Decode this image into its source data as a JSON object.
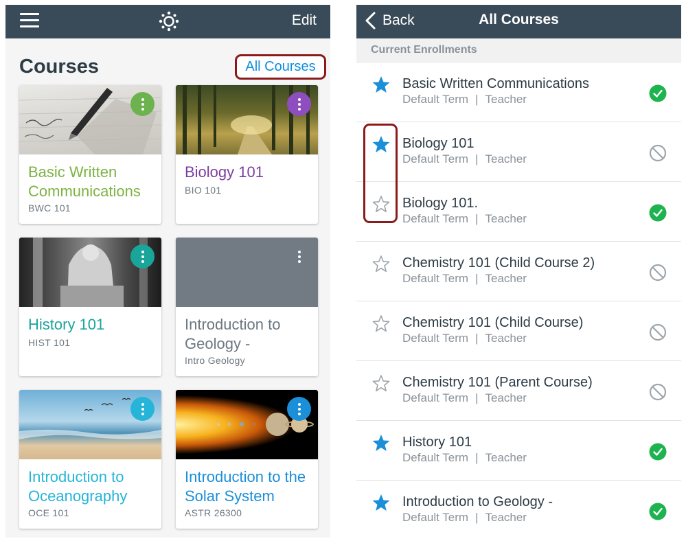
{
  "colors": {
    "nav_bg": "#394b58",
    "accent": "#0b8fdc",
    "highlight_border": "#8b1a1a",
    "check_green": "#1db34f"
  },
  "left": {
    "edit_label": "Edit",
    "heading": "Courses",
    "all_courses_label": "All Courses",
    "cards": [
      {
        "title": "Basic Written Communications",
        "code": "BWC 101",
        "title_color": "#7cb342",
        "dots_color": "#6cb34f",
        "image": "pen-writing"
      },
      {
        "title": "Biology 101",
        "code": "BIO 101",
        "title_color": "#7b3ea0",
        "dots_color": "#8e4ec0",
        "image": "forest-path"
      },
      {
        "title": "History 101",
        "code": "HIST 101",
        "title_color": "#1aa59b",
        "dots_color": "#1aa59b",
        "image": "lincoln-statue"
      },
      {
        "title": "Introduction to Geology -",
        "code": "Intro Geology",
        "title_color": "#6c7780",
        "dots_color": "#727a84",
        "image": "gray-placeholder"
      },
      {
        "title": "Introduction to Oceanography",
        "code": "OCE 101",
        "title_color": "#26b5d8",
        "dots_color": "#26b5d8",
        "image": "beach-sunrise"
      },
      {
        "title": "Introduction to the Solar System",
        "code": "ASTR 26300",
        "title_color": "#1b8fd8",
        "dots_color": "#1b8fd8",
        "image": "sun-and-planets"
      }
    ]
  },
  "right": {
    "back_label": "Back",
    "title": "All Courses",
    "section_label": "Current Enrollments",
    "rows": [
      {
        "name": "Basic Written Communications",
        "term": "Default Term",
        "role": "Teacher",
        "favorite": true,
        "published": true
      },
      {
        "name": "Biology 101",
        "term": "Default Term",
        "role": "Teacher",
        "favorite": true,
        "published": false
      },
      {
        "name": "Biology 101.",
        "term": "Default Term",
        "role": "Teacher",
        "favorite": false,
        "published": true
      },
      {
        "name": "Chemistry 101 (Child Course 2)",
        "term": "Default Term",
        "role": "Teacher",
        "favorite": false,
        "published": false
      },
      {
        "name": "Chemistry 101 (Child Course)",
        "term": "Default Term",
        "role": "Teacher",
        "favorite": false,
        "published": false
      },
      {
        "name": "Chemistry 101 (Parent Course)",
        "term": "Default Term",
        "role": "Teacher",
        "favorite": false,
        "published": false
      },
      {
        "name": "History 101",
        "term": "Default Term",
        "role": "Teacher",
        "favorite": true,
        "published": true
      },
      {
        "name": "Introduction to Geology -",
        "term": "Default Term",
        "role": "Teacher",
        "favorite": true,
        "published": true
      }
    ],
    "meta_separator": "|"
  },
  "icons": {
    "menu": "hamburger-icon",
    "logo": "canvas-logo-icon",
    "back": "chevron-left-icon",
    "favorite_on": "star-filled-icon",
    "favorite_off": "star-outline-icon",
    "published": "check-circle-icon",
    "unpublished": "no-entry-icon",
    "card_menu": "more-vertical-icon"
  }
}
